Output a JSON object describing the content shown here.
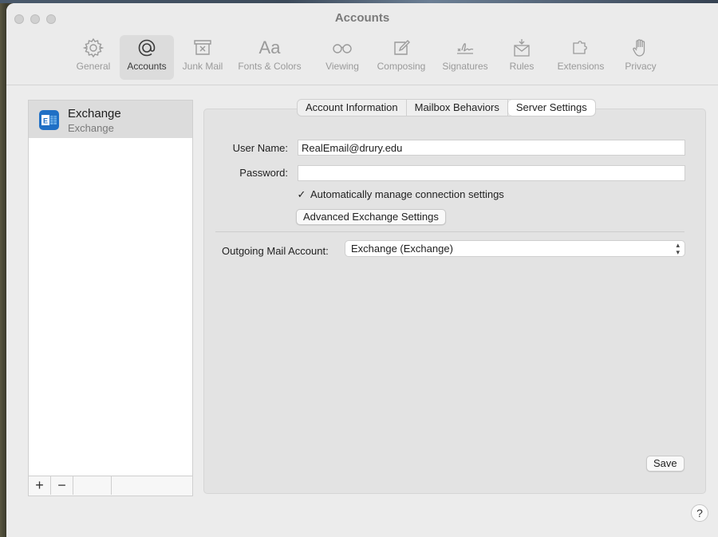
{
  "window": {
    "title": "Accounts"
  },
  "toolbar": {
    "items": [
      {
        "label": "General",
        "icon": "gear-icon"
      },
      {
        "label": "Accounts",
        "icon": "at-sign-icon",
        "active": true
      },
      {
        "label": "Junk Mail",
        "icon": "junk-tray-icon"
      },
      {
        "label": "Fonts & Colors",
        "icon": "font-aa-icon"
      },
      {
        "label": "Viewing",
        "icon": "glasses-icon"
      },
      {
        "label": "Composing",
        "icon": "pencil-square-icon"
      },
      {
        "label": "Signatures",
        "icon": "signature-icon"
      },
      {
        "label": "Rules",
        "icon": "envelope-rules-icon"
      },
      {
        "label": "Extensions",
        "icon": "puzzle-icon"
      },
      {
        "label": "Privacy",
        "icon": "raised-hand-icon"
      }
    ]
  },
  "sidebar": {
    "accounts": [
      {
        "name": "Exchange",
        "type": "Exchange",
        "icon": "exchange-icon"
      }
    ],
    "add_label": "+",
    "remove_label": "−"
  },
  "tabs": [
    {
      "label": "Account Information"
    },
    {
      "label": "Mailbox Behaviors"
    },
    {
      "label": "Server Settings",
      "selected": true
    }
  ],
  "form": {
    "username_label": "User Name:",
    "username_value": "RealEmail@drury.edu",
    "password_label": "Password:",
    "password_value": "",
    "auto_manage_label": "Automatically manage connection settings",
    "auto_manage_checked": true,
    "advanced_button": "Advanced Exchange Settings",
    "outgoing_label": "Outgoing Mail Account:",
    "outgoing_value": "Exchange (Exchange)",
    "save_button": "Save"
  },
  "help": {
    "label": "?"
  },
  "colors": {
    "window_bg": "#ececec",
    "panel_bg": "#e3e3e3",
    "exchange_blue": "#1f6fc5"
  }
}
